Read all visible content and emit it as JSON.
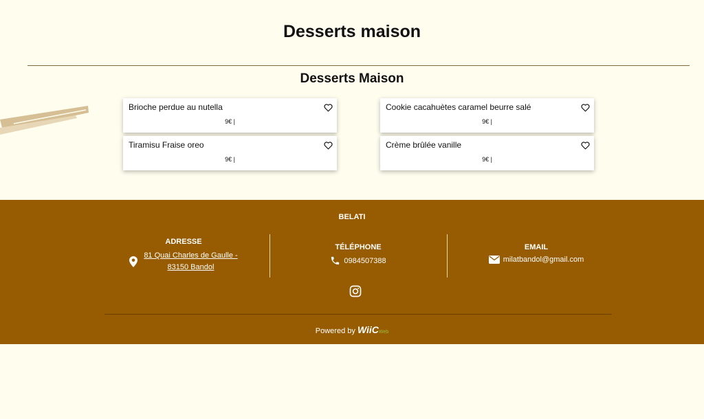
{
  "page": {
    "title": "Desserts maison"
  },
  "section": {
    "title": "Desserts Maison",
    "items": [
      {
        "name": "Brioche perdue au nutella",
        "price": "9€ |"
      },
      {
        "name": "Cookie cacahuètes caramel beurre salé",
        "price": "9€ |"
      },
      {
        "name": "Tiramisu Fraise oreo",
        "price": "9€ |"
      },
      {
        "name": "Crème brûlée vanille",
        "price": "9€ |"
      }
    ]
  },
  "footer": {
    "brand": "BELATI",
    "address": {
      "title": "ADRESSE",
      "line1": "81 Quai Charles de Gaulle -",
      "line2": "83150 Bandol"
    },
    "phone": {
      "title": "TÉLÉPHONE",
      "value": "0984507388"
    },
    "email": {
      "title": "EMAIL",
      "value": "milatbandol@gmail.com"
    },
    "powered_by": "Powered by",
    "powered_brand": "WiiC",
    "powered_sub": "Web"
  },
  "colors": {
    "background": "#fffdee",
    "footer": "#975b01",
    "accent": "#9bbf3a"
  },
  "icons": [
    "heart-icon",
    "map-pin-icon",
    "phone-icon",
    "envelope-icon",
    "instagram-icon"
  ]
}
